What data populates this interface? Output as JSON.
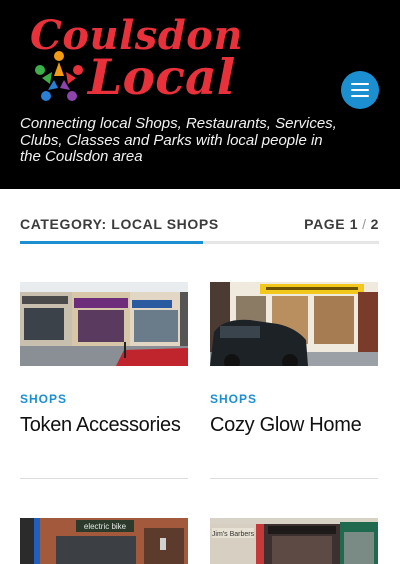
{
  "site": {
    "name_line1": "Coulsdon",
    "name_line2": "Local",
    "tagline": "Connecting local Shops, Restaurants, Services, Clubs, Classes and Parks with local people in the Coulsdon area",
    "brand_color": "#e8313a",
    "accent_color": "#1c8fd0",
    "menu_icon": "hamburger-menu-icon"
  },
  "category": {
    "title": "CATEGORY: LOCAL SHOPS",
    "page_label": "PAGE",
    "page_current": "1",
    "page_separator": "/",
    "page_total": "2"
  },
  "posts": [
    {
      "category": "SHOPS",
      "title": "Token Accessories",
      "image": "token-accessories-storefront-photo"
    },
    {
      "category": "SHOPS",
      "title": "Cozy Glow Home",
      "image": "cozy-glow-home-storefront-photo"
    },
    {
      "category": "",
      "title": "",
      "image": "electric-bike-storefront-photo",
      "sign_text": "electric bike"
    },
    {
      "category": "",
      "title": "",
      "image": "jims-barbers-storefront-photo",
      "sign_text": "Jim's Barbers"
    }
  ]
}
